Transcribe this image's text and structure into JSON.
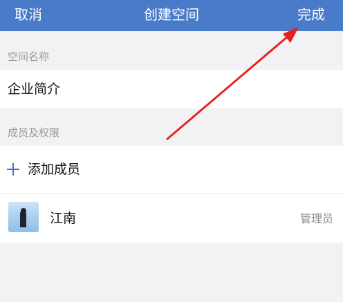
{
  "navbar": {
    "cancel_label": "取消",
    "title": "创建空间",
    "done_label": "完成",
    "background": "#4a7bc9"
  },
  "space_name": {
    "section_label": "空间名称",
    "value": "企业简介"
  },
  "members": {
    "section_label": "成员及权限",
    "add_label": "添加成员",
    "items": [
      {
        "name": "江南",
        "role": "管理员",
        "avatar_icon": "user-avatar"
      }
    ]
  },
  "annotation": {
    "arrow_color": "#e8231d",
    "icon": "red-arrow-pointing-to-done"
  }
}
